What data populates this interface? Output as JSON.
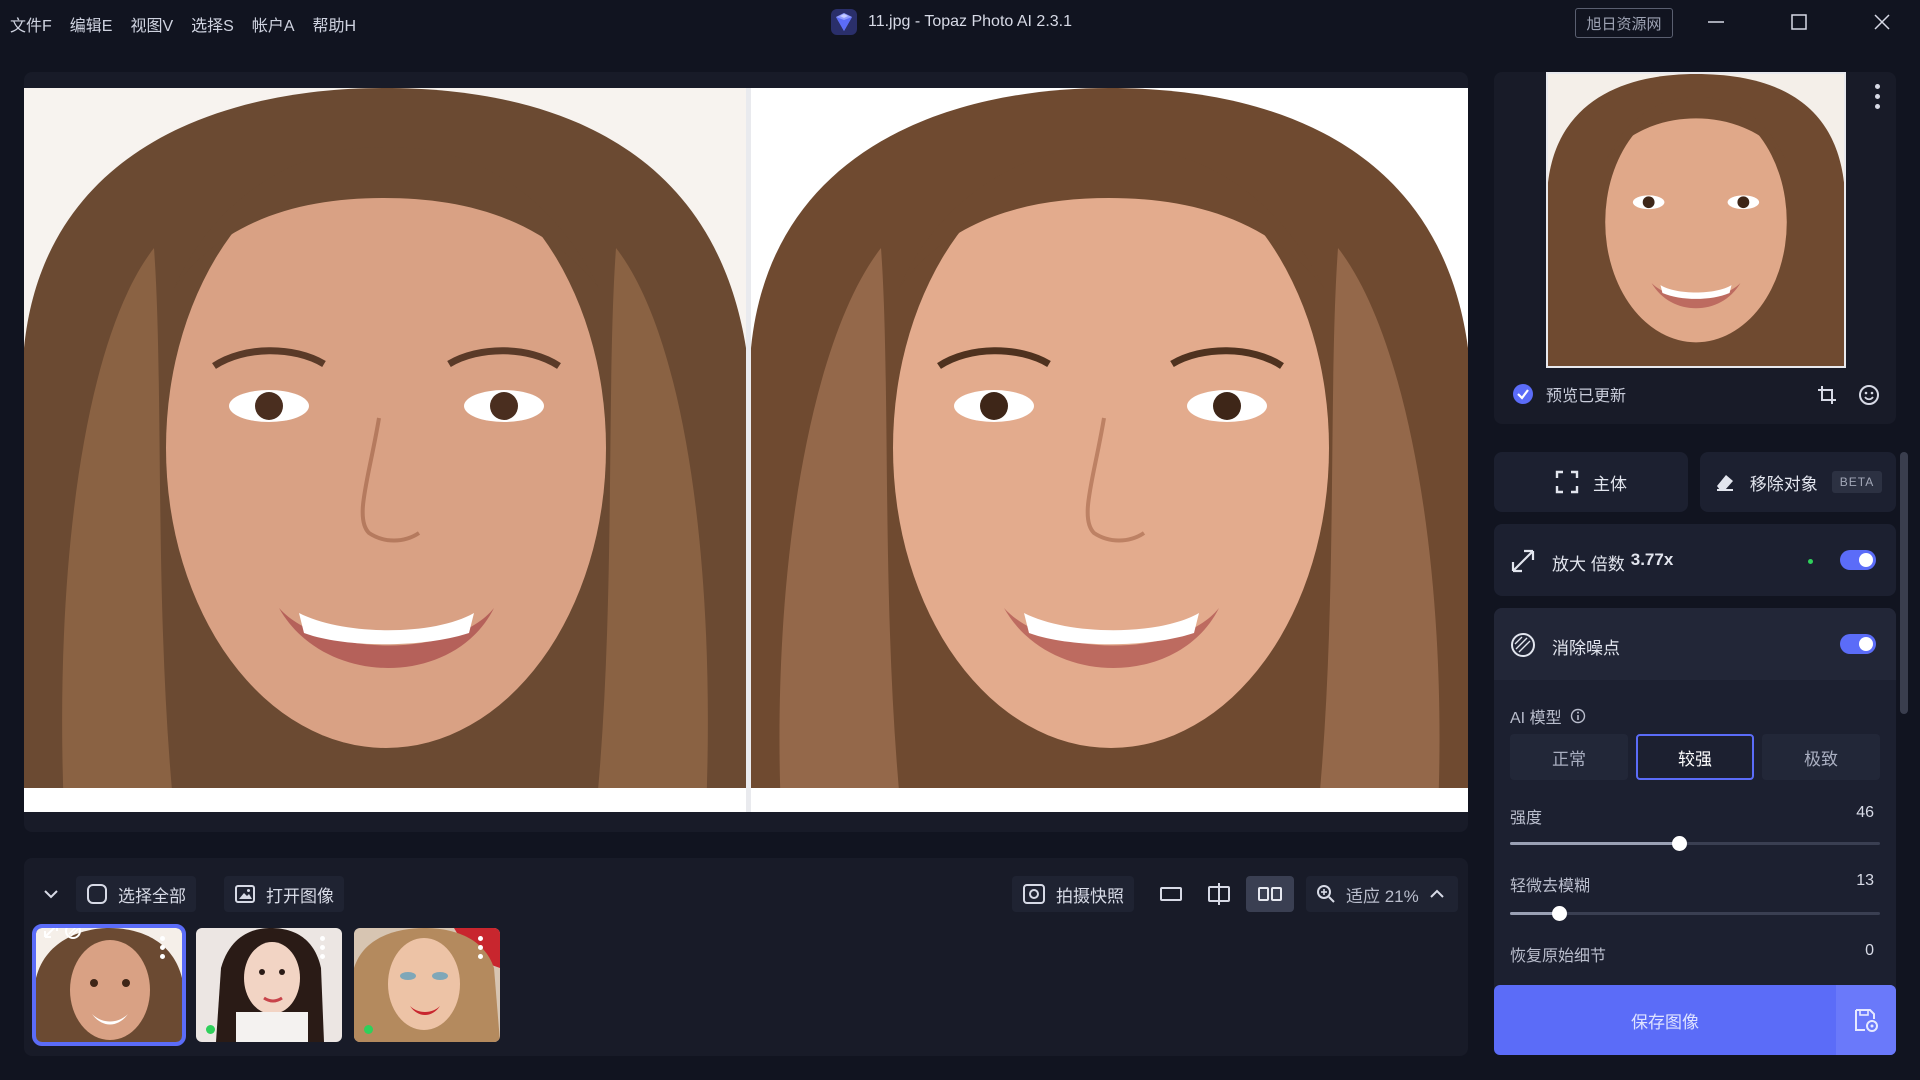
{
  "window": {
    "title": "11.jpg - Topaz Photo AI 2.3.1",
    "watermark": "旭日资源网"
  },
  "menu": [
    "文件F",
    "编辑E",
    "视图V",
    "选择S",
    "帐户A",
    "帮助H"
  ],
  "toolbar": {
    "select_all": "选择全部",
    "open_image": "打开图像",
    "snapshot": "拍摄快照",
    "zoom": "适应 21%"
  },
  "preview": {
    "status": "预览已更新"
  },
  "panel": {
    "subject": "主体",
    "remove_object": "移除对象",
    "beta": "BETA",
    "upscale_label": "放大 倍数",
    "upscale_value": "3.77x",
    "upscale_enabled": true,
    "denoise_label": "消除噪点",
    "denoise_enabled": true,
    "ai_model_label": "AI 模型",
    "models": [
      "正常",
      "较强",
      "极致"
    ],
    "active_model": "较强",
    "sliders": [
      {
        "label": "强度",
        "value": 46
      },
      {
        "label": "轻微去模糊",
        "value": 13
      },
      {
        "label": "恢复原始细节",
        "value": 0
      }
    ]
  },
  "save": {
    "label": "保存图像"
  },
  "colors": {
    "accent": "#5b6cf8",
    "background": "#111420",
    "panel": "#1c2030"
  }
}
